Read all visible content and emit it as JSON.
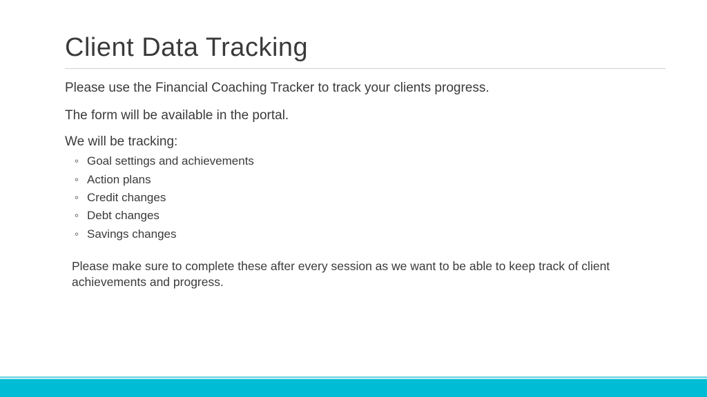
{
  "slide": {
    "title": "Client Data Tracking",
    "para1": "Please use the Financial Coaching Tracker to track your clients progress.",
    "para2": "The form will be available in the portal.",
    "tracking_label": "We will be tracking:",
    "bullets": {
      "0": "Goal settings and achievements",
      "1": "Action plans",
      "2": "Credit changes",
      "3": "Debt changes",
      "4": "Savings changes"
    },
    "closing": "Please make sure to complete these after every session as we want to be able to keep track of client achievements and progress."
  }
}
